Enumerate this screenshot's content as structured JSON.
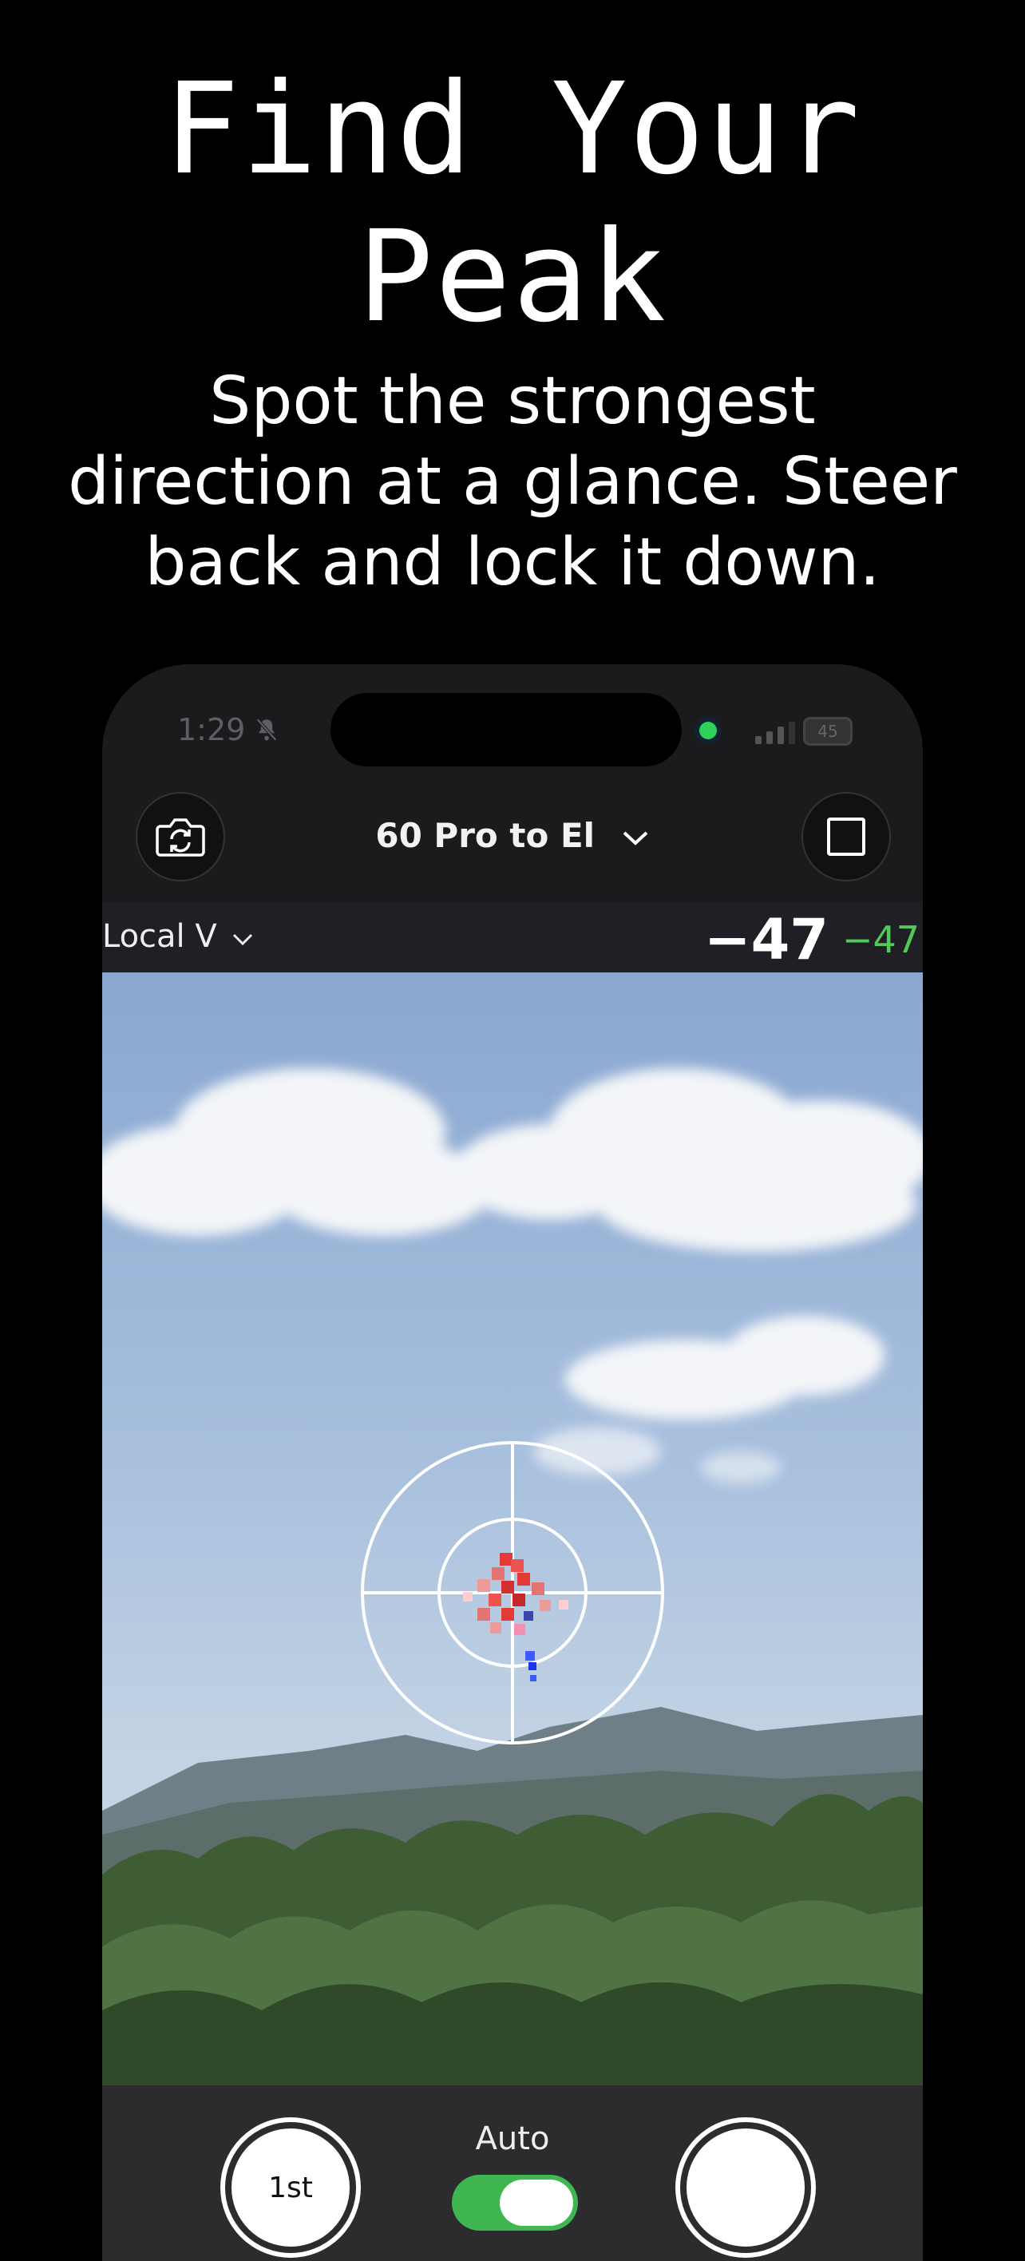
{
  "promo": {
    "headline_line1": "Find Your",
    "headline_line2": "Peak",
    "subline_line1": "Spot the strongest",
    "subline_line2": "direction at a glance. Steer",
    "subline_line3": "back and lock it down."
  },
  "status_bar": {
    "time": "1:29",
    "battery": "45"
  },
  "toolbar": {
    "profile_label": "60 Pro to El",
    "switch_camera_icon": "camera-rotate-icon",
    "stop_icon": "square-stop-icon"
  },
  "info_bar": {
    "mode_label": "Local V",
    "reading_main": "−47",
    "reading_secondary": "−47"
  },
  "bottom_bar": {
    "first_button_label": "1st",
    "auto_label": "Auto",
    "auto_enabled": true
  },
  "colors": {
    "accent_green": "#3fb650",
    "heat_red": "#e53935",
    "heat_blue": "#2233ee"
  }
}
